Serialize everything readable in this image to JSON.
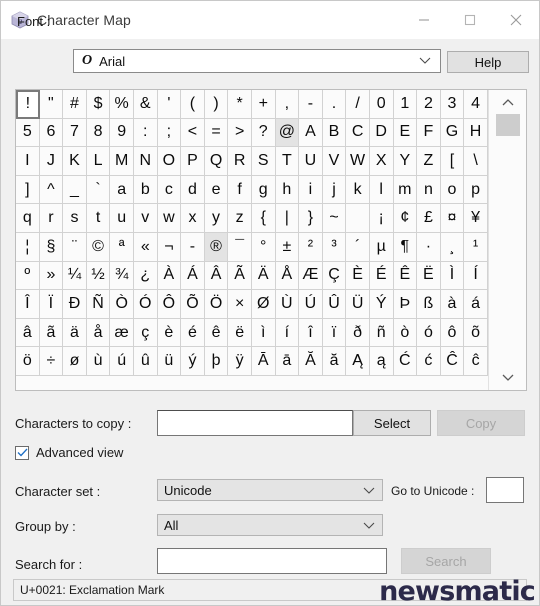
{
  "window": {
    "title": "Character Map",
    "icon": "character-map-icon",
    "minimize_label": "–",
    "maximize_label": "□",
    "close_label": "✕"
  },
  "font": {
    "label": "Font :",
    "value": "Arial",
    "type_icon": "O",
    "help_label": "Help"
  },
  "grid": {
    "rows": [
      [
        "!",
        "\"",
        "#",
        "$",
        "%",
        "&",
        "'",
        "(",
        ")",
        "*",
        "+",
        ",",
        "-",
        ".",
        "/",
        "0",
        "1",
        "2",
        "3",
        "4"
      ],
      [
        "5",
        "6",
        "7",
        "8",
        "9",
        ":",
        ";",
        "<",
        "=",
        ">",
        "?",
        "@",
        "A",
        "B",
        "C",
        "D",
        "E",
        "F",
        "G",
        "H"
      ],
      [
        "I",
        "J",
        "K",
        "L",
        "M",
        "N",
        "O",
        "P",
        "Q",
        "R",
        "S",
        "T",
        "U",
        "V",
        "W",
        "X",
        "Y",
        "Z",
        "[",
        "\\"
      ],
      [
        "]",
        "^",
        "_",
        "`",
        "a",
        "b",
        "c",
        "d",
        "e",
        "f",
        "g",
        "h",
        "i",
        "j",
        "k",
        "l",
        "m",
        "n",
        "o",
        "p"
      ],
      [
        "q",
        "r",
        "s",
        "t",
        "u",
        "v",
        "w",
        "x",
        "y",
        "z",
        "{",
        "|",
        "}",
        "~",
        "",
        "¡",
        "¢",
        "£",
        "¤",
        "¥"
      ],
      [
        "¦",
        "§",
        "¨",
        "©",
        "ª",
        "«",
        "¬",
        "-",
        "®",
        "¯",
        "°",
        "±",
        "²",
        "³",
        "´",
        "µ",
        "¶",
        "·",
        "¸",
        "¹"
      ],
      [
        "º",
        "»",
        "¼",
        "½",
        "¾",
        "¿",
        "À",
        "Á",
        "Â",
        "Ã",
        "Ä",
        "Å",
        "Æ",
        "Ç",
        "È",
        "É",
        "Ê",
        "Ë",
        "Ì",
        "Í"
      ],
      [
        "Î",
        "Ï",
        "Ð",
        "Ñ",
        "Ò",
        "Ó",
        "Ô",
        "Õ",
        "Ö",
        "×",
        "Ø",
        "Ù",
        "Ú",
        "Û",
        "Ü",
        "Ý",
        "Þ",
        "ß",
        "à",
        "á"
      ],
      [
        "â",
        "ã",
        "ä",
        "å",
        "æ",
        "ç",
        "è",
        "é",
        "ê",
        "ë",
        "ì",
        "í",
        "î",
        "ï",
        "ð",
        "ñ",
        "ò",
        "ó",
        "ô",
        "õ"
      ],
      [
        "ö",
        "÷",
        "ø",
        "ù",
        "ú",
        "û",
        "ü",
        "ý",
        "þ",
        "ÿ",
        "Ā",
        "ā",
        "Ă",
        "ă",
        "Ą",
        "ą",
        "Ć",
        "ć",
        "Ĉ",
        "ĉ"
      ]
    ],
    "selected": {
      "row": 0,
      "col": 0
    },
    "hovered": [
      {
        "row": 1,
        "col": 11
      },
      {
        "row": 5,
        "col": 8
      }
    ],
    "scrollbar": {
      "up_icon": "chevron-up-icon",
      "down_icon": "chevron-down-icon"
    }
  },
  "copy_row": {
    "label": "Characters to copy :",
    "input_value": "",
    "input_placeholder": "",
    "select_label": "Select",
    "copy_label": "Copy",
    "copy_enabled": false
  },
  "advanced": {
    "label": "Advanced view",
    "checked": true,
    "check_glyph": "✓"
  },
  "charset": {
    "label": "Character set :",
    "value": "Unicode"
  },
  "goto": {
    "label": "Go to Unicode :",
    "value": "",
    "placeholder": ""
  },
  "groupby": {
    "label": "Group by :",
    "value": "All"
  },
  "search": {
    "label": "Search for :",
    "value": "",
    "placeholder": "",
    "button_label": "Search",
    "button_enabled": false
  },
  "status": {
    "text": "U+0021: Exclamation Mark"
  },
  "watermark": {
    "text": "newsmatic",
    "color": "#2c2a4a"
  }
}
